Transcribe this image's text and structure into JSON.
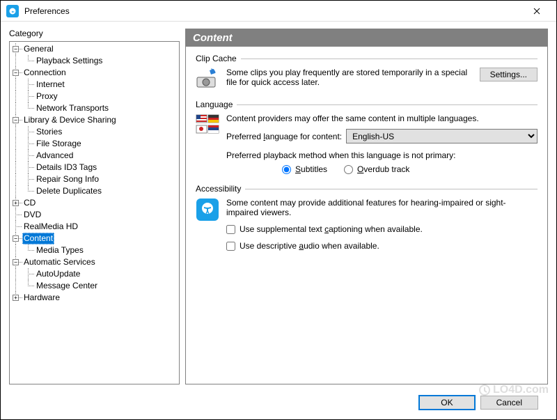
{
  "window": {
    "title": "Preferences"
  },
  "sidebar": {
    "label": "Category",
    "tree": {
      "general": "General",
      "playback_settings": "Playback Settings",
      "connection": "Connection",
      "internet": "Internet",
      "proxy": "Proxy",
      "network_transports": "Network Transports",
      "library": "Library & Device Sharing",
      "stories": "Stories",
      "file_storage": "File Storage",
      "advanced": "Advanced",
      "details_id3": "Details ID3 Tags",
      "repair_song": "Repair Song Info",
      "delete_dup": "Delete Duplicates",
      "cd": "CD",
      "dvd": "DVD",
      "realmedia_hd": "RealMedia HD",
      "content": "Content",
      "media_types": "Media Types",
      "auto_services": "Automatic Services",
      "autoupdate": "AutoUpdate",
      "message_center": "Message Center",
      "hardware": "Hardware"
    }
  },
  "panel": {
    "title": "Content",
    "clip_cache": {
      "group": "Clip Cache",
      "text": "Some clips you play frequently are stored temporarily in a special file for quick access later.",
      "settings_btn": "Settings..."
    },
    "language": {
      "group": "Language",
      "text": "Content providers may offer the same content in multiple languages.",
      "pref_label_pre": "Preferred ",
      "pref_label_u": "l",
      "pref_label_post": "anguage for content:",
      "selected": "English-US",
      "method_label": "Preferred playback method when this language is not primary:",
      "subtitles_u": "S",
      "subtitles_post": "ubtitles",
      "overdub_u": "O",
      "overdub_post": "verdub track"
    },
    "accessibility": {
      "group": "Accessibility",
      "text": "Some content may provide additional features for hearing-impaired or sight-impaired viewers.",
      "caption_pre": "Use supplemental text ",
      "caption_u": "c",
      "caption_post": "aptioning when available.",
      "audio_pre": "Use descriptive ",
      "audio_u": "a",
      "audio_post": "udio when available."
    }
  },
  "buttons": {
    "ok": "OK",
    "cancel": "Cancel"
  },
  "watermark": "LO4D.com"
}
